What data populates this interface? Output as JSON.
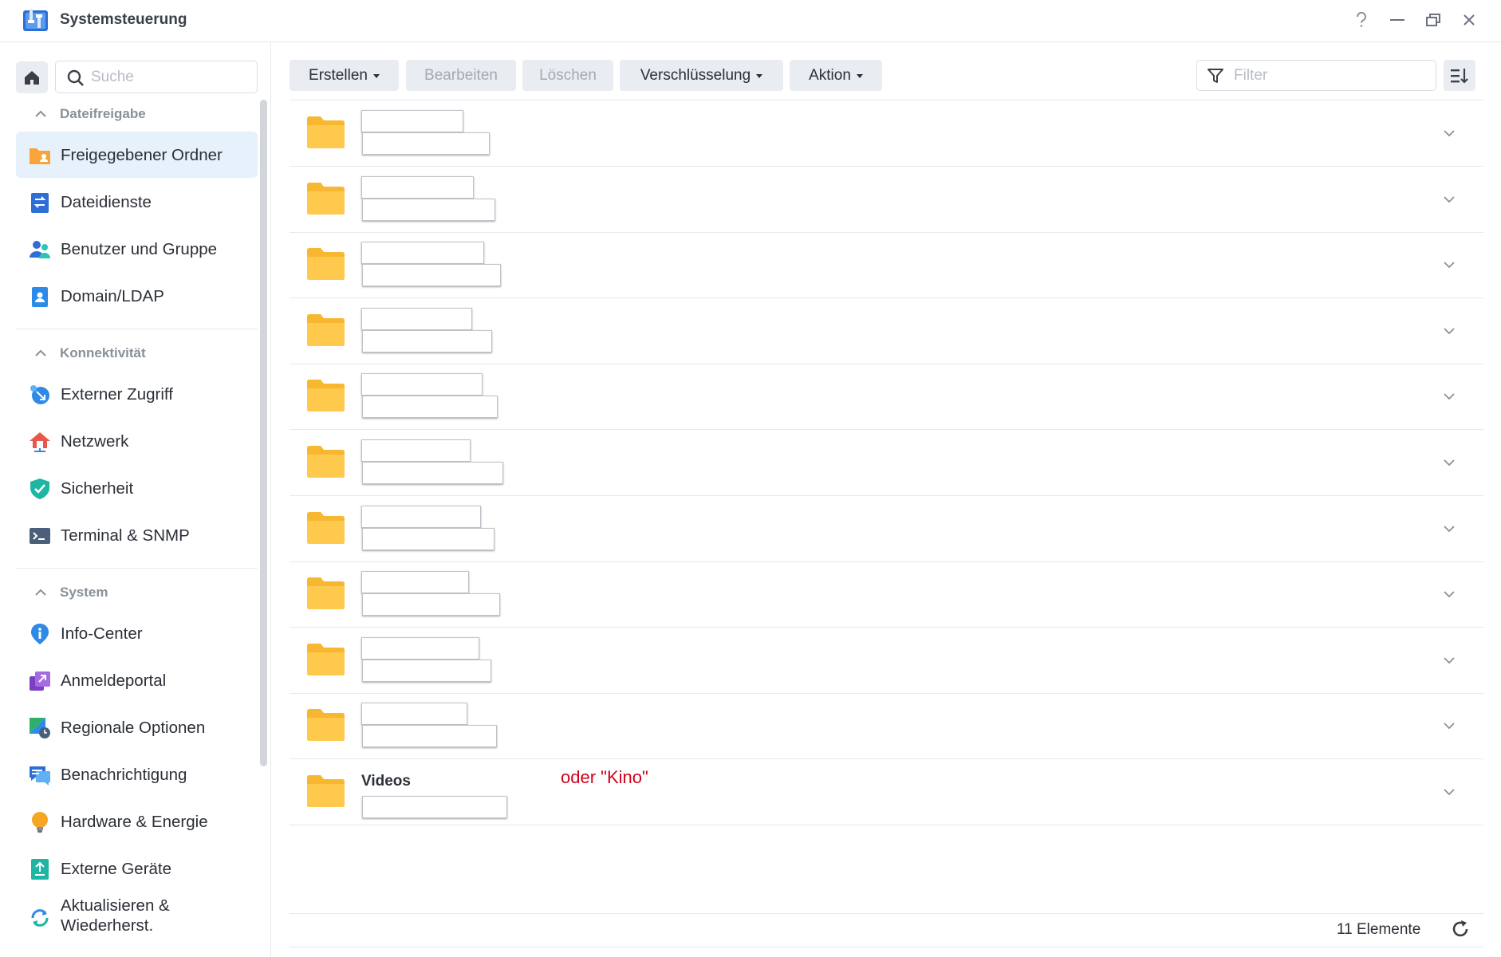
{
  "window": {
    "title": "Systemsteuerung",
    "help_icon": "help-icon",
    "minimize_icon": "minimize-icon",
    "restore_icon": "restore-icon",
    "close_icon": "close-icon"
  },
  "sidebar": {
    "search_placeholder": "Suche",
    "sections": [
      {
        "title": "Dateifreigabe",
        "items": [
          {
            "label": "Freigegebener Ordner",
            "icon": "shared-folder-icon",
            "active": true
          },
          {
            "label": "Dateidienste",
            "icon": "file-services-icon"
          },
          {
            "label": "Benutzer und Gruppe",
            "icon": "users-icon"
          },
          {
            "label": "Domain/LDAP",
            "icon": "domain-ldap-icon"
          }
        ]
      },
      {
        "title": "Konnektivität",
        "items": [
          {
            "label": "Externer Zugriff",
            "icon": "external-access-icon"
          },
          {
            "label": "Netzwerk",
            "icon": "network-icon"
          },
          {
            "label": "Sicherheit",
            "icon": "security-shield-icon"
          },
          {
            "label": "Terminal & SNMP",
            "icon": "terminal-icon"
          }
        ]
      },
      {
        "title": "System",
        "items": [
          {
            "label": "Info-Center",
            "icon": "info-center-icon"
          },
          {
            "label": "Anmeldeportal",
            "icon": "login-portal-icon"
          },
          {
            "label": "Regionale Optionen",
            "icon": "regional-options-icon"
          },
          {
            "label": "Benachrichtigung",
            "icon": "notification-icon"
          },
          {
            "label": "Hardware & Energie",
            "icon": "hardware-power-icon"
          },
          {
            "label": "Externe Geräte",
            "icon": "external-devices-icon"
          },
          {
            "label": "Aktualisieren & Wiederherst.",
            "icon": "update-restore-icon"
          }
        ]
      }
    ]
  },
  "toolbar": {
    "create": "Erstellen",
    "edit": "Bearbeiten",
    "delete": "Löschen",
    "encryption": "Verschlüsselung",
    "action": "Aktion",
    "filter_placeholder": "Filter"
  },
  "folders": [
    {
      "name": ""
    },
    {
      "name": ""
    },
    {
      "name": ""
    },
    {
      "name": ""
    },
    {
      "name": ""
    },
    {
      "name": ""
    },
    {
      "name": ""
    },
    {
      "name": ""
    },
    {
      "name": ""
    },
    {
      "name": ""
    },
    {
      "name": "Videos"
    }
  ],
  "annotation": "oder \"Kino\"",
  "footer": {
    "count": "11 Elemente"
  },
  "colors": {
    "accent": "#1f7de6",
    "active_bg": "#e6f1fc",
    "folder": "#ffc94d",
    "annotation": "#d0021b"
  }
}
